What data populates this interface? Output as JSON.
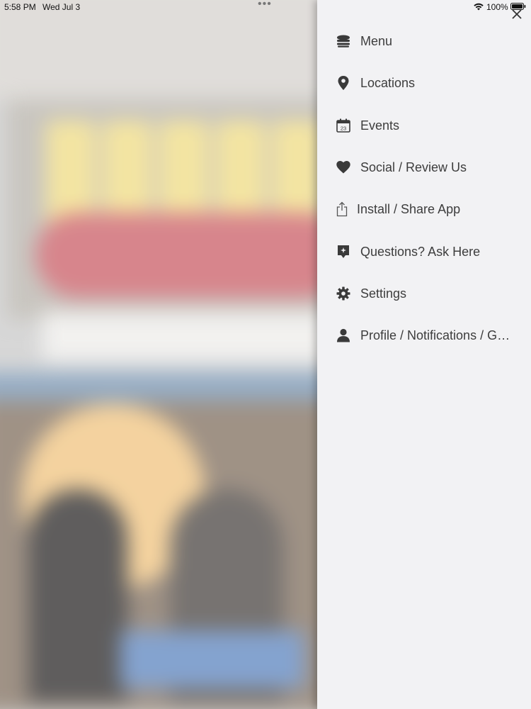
{
  "status_bar": {
    "time": "5:58 PM",
    "date": "Wed Jul 3",
    "more_dots": "•••",
    "battery_percent": "100%",
    "battery_level": 1.0
  },
  "drawer": {
    "items": [
      {
        "label": "Menu",
        "icon": "menu-stack-icon"
      },
      {
        "label": "Locations",
        "icon": "map-pin-icon"
      },
      {
        "label": "Events",
        "icon": "calendar-icon",
        "icon_text": "23"
      },
      {
        "label": "Social / Review Us",
        "icon": "heart-icon"
      },
      {
        "label": "Install / Share App",
        "icon": "share-icon"
      },
      {
        "label": "Questions? Ask Here",
        "icon": "question-bubble-icon"
      },
      {
        "label": "Settings",
        "icon": "gear-icon"
      },
      {
        "label": "Profile / Notifications / Gift Cards",
        "icon": "person-icon"
      }
    ]
  },
  "colors": {
    "drawer_background": "#f2f2f4",
    "label_text": "#3d3d3d",
    "icon": "#3a3a3a"
  }
}
